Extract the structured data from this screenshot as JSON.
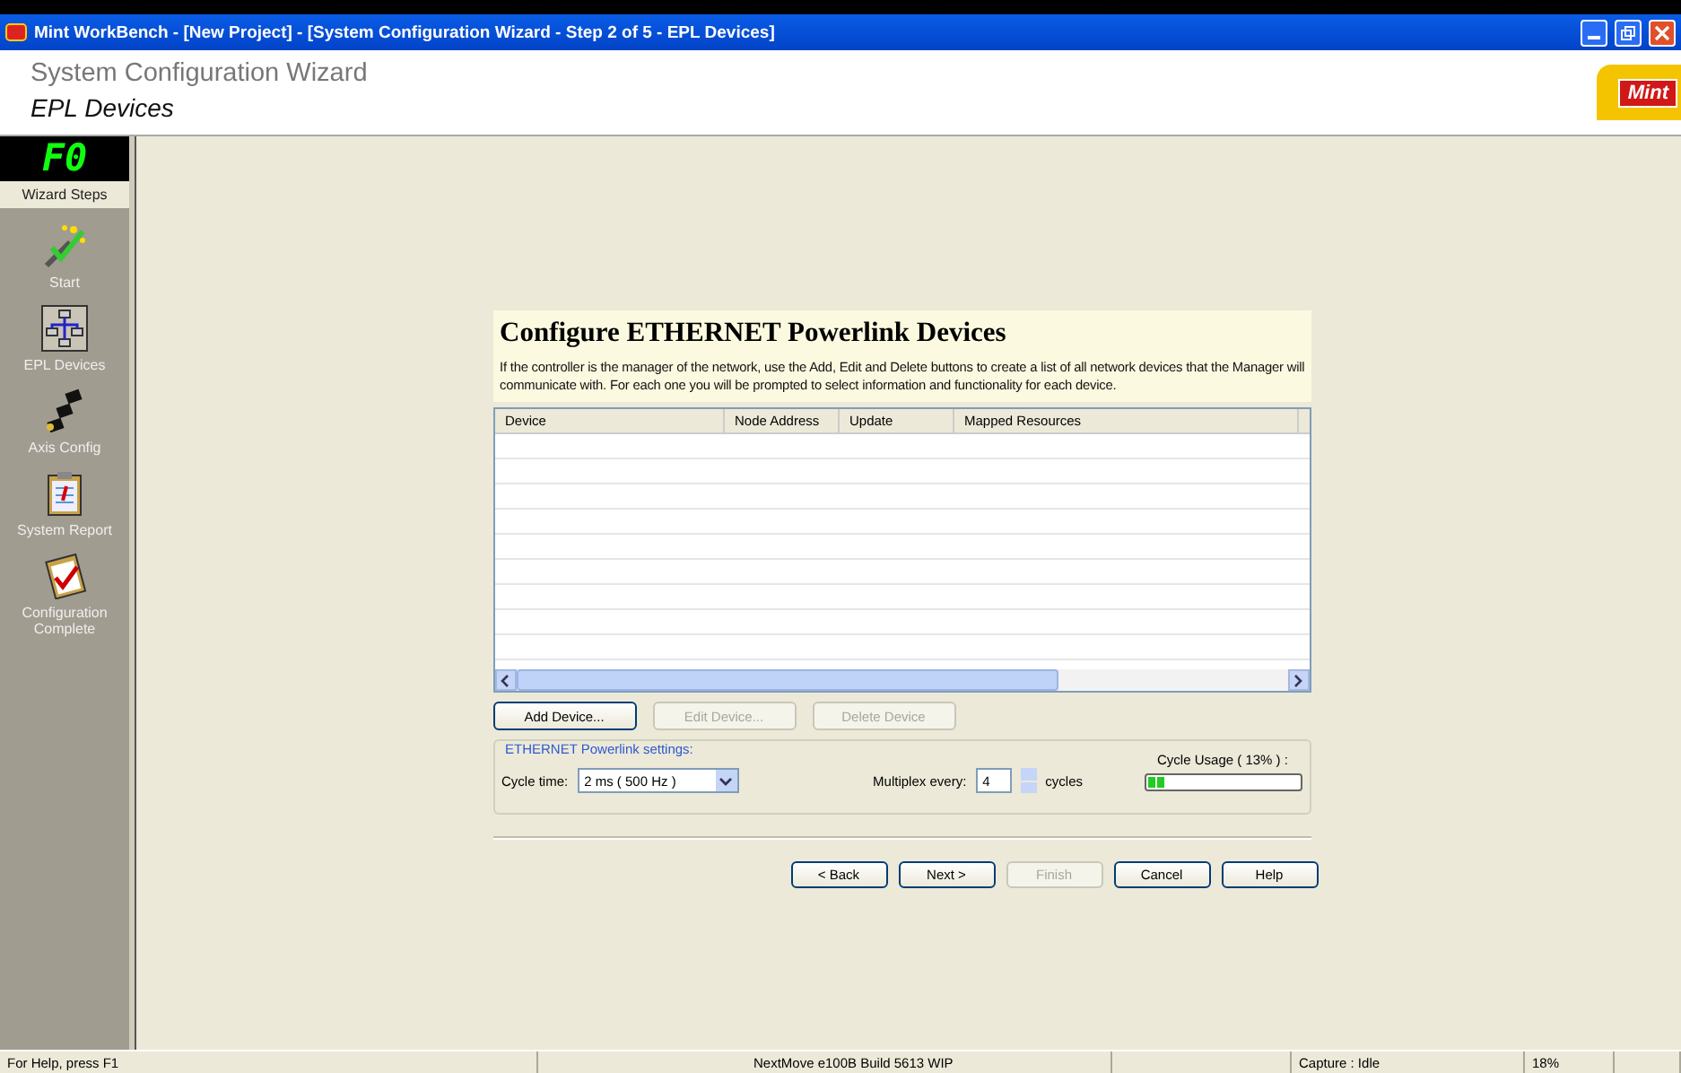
{
  "window": {
    "title": "Mint WorkBench - [New Project] - [System Configuration Wizard - Step 2 of 5 - EPL Devices]"
  },
  "header": {
    "title": "System Configuration Wizard",
    "subtitle": "EPL Devices",
    "logo": "Mint"
  },
  "sidebar": {
    "display": "F0",
    "heading": "Wizard Steps",
    "items": [
      {
        "label": "Start",
        "kind": "wand",
        "selected": false
      },
      {
        "label": "EPL Devices",
        "kind": "network",
        "selected": true
      },
      {
        "label": "Axis Config",
        "kind": "axes",
        "selected": false
      },
      {
        "label": "System Report",
        "kind": "report",
        "selected": false
      },
      {
        "label": "Configuration Complete",
        "kind": "complete",
        "selected": false
      }
    ]
  },
  "page": {
    "title": "Configure ETHERNET Powerlink Devices",
    "description": "If the controller is the manager of the network, use the Add, Edit and Delete buttons to create a list of all network devices that the Manager will communicate with. For each one you will be prompted to select information and functionality for each device.",
    "table": {
      "columns": [
        "Device",
        "Node Address",
        "Update",
        "Mapped Resources"
      ]
    },
    "device_buttons": [
      {
        "label": "Add Device...",
        "disabled": false
      },
      {
        "label": "Edit Device...",
        "disabled": true
      },
      {
        "label": "Delete Device",
        "disabled": true
      }
    ],
    "settings": {
      "legend": "ETHERNET Powerlink settings:",
      "cycle_time_label": "Cycle time:",
      "cycle_time": "2 ms ( 500 Hz )",
      "multiplex_label": "Multiplex every:",
      "multiplex": "4",
      "multiplex_unit": "cycles",
      "usage_label": "Cycle Usage ( 13% ) :",
      "usage": {
        "level": 0.13
      }
    },
    "nav_buttons": [
      {
        "label": "< Back",
        "disabled": false
      },
      {
        "label": "Next >",
        "disabled": false
      },
      {
        "label": "Finish",
        "disabled": true
      },
      {
        "label": "Cancel",
        "disabled": false
      },
      {
        "label": "Help",
        "disabled": false
      }
    ]
  },
  "status_bar": [
    "For Help, press F1",
    "NextMove e100B Build 5613 WIP",
    "Capture : Idle",
    "18%"
  ]
}
